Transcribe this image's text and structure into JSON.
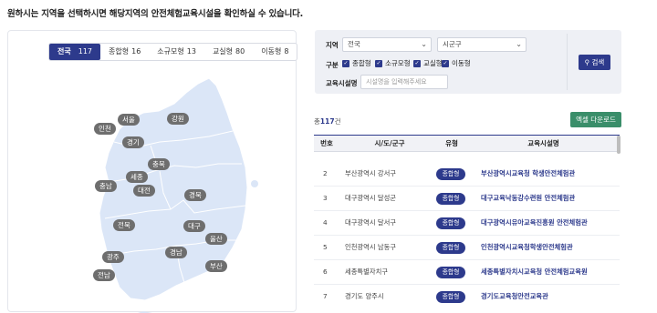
{
  "headline": "원하시는 지역을 선택하시면 해당지역의 안전체험교육시설을 확인하실 수 있습니다.",
  "tabs": [
    {
      "label": "전국",
      "count": "117"
    },
    {
      "label": "종합형",
      "count": "16"
    },
    {
      "label": "소규모형",
      "count": "13"
    },
    {
      "label": "교실형",
      "count": "80"
    },
    {
      "label": "이동형",
      "count": "8"
    }
  ],
  "regions": [
    "서울",
    "인천",
    "경기",
    "강원",
    "충북",
    "세종",
    "충남",
    "대전",
    "경북",
    "전북",
    "대구",
    "울산",
    "광주",
    "경남",
    "부산",
    "전남"
  ],
  "colors": {
    "primary": "#2d3a8c",
    "excel": "#3a8e6a",
    "map_fill": "#dbe6f7",
    "region_badge": "#6e6e6e"
  },
  "search": {
    "region_label": "지역",
    "sido_value": "전국",
    "sigungu_value": "시군구",
    "type_label": "구분",
    "types": [
      "종합형",
      "소규모형",
      "교실형",
      "이동형"
    ],
    "facility_label": "교육시설명",
    "facility_placeholder": "시설명을 입력해주세요",
    "search_button": "검색"
  },
  "total_prefix": "총",
  "total_count": "117",
  "total_suffix": "건",
  "excel_button": "엑셀 다운로드",
  "table": {
    "headers": [
      "번호",
      "시/도/군구",
      "유형",
      "교육시설명"
    ],
    "rows": [
      {
        "no": "2",
        "area": "부산광역시 강서구",
        "type": "종합형",
        "name": "부산광역시교육청 학생안전체험관"
      },
      {
        "no": "3",
        "area": "대구광역시 달성군",
        "type": "종합형",
        "name": "대구교육낙동강수련원 안전체험관"
      },
      {
        "no": "4",
        "area": "대구광역시 달서구",
        "type": "종합형",
        "name": "대구광역시유아교육진흥원 안전체험관"
      },
      {
        "no": "5",
        "area": "인천광역시 남동구",
        "type": "종합형",
        "name": "인천광역시교육청학생안전체험관"
      },
      {
        "no": "6",
        "area": "세종특별자치구",
        "type": "종합형",
        "name": "세종특별자치시교육청 안전체험교육원"
      },
      {
        "no": "7",
        "area": "경기도 양주시",
        "type": "종합형",
        "name": "경기도교육청안전교육관"
      }
    ]
  }
}
